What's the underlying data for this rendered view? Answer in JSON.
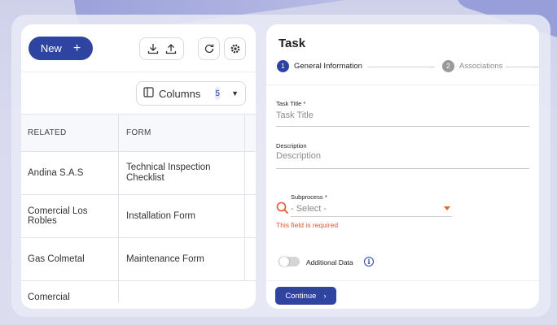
{
  "toolbar": {
    "new_label": "New",
    "new_icon": "plus-icon",
    "download_icon": "download-icon",
    "upload_icon": "upload-icon",
    "refresh_icon": "refresh-icon",
    "settings_icon": "gear-icon"
  },
  "columns_control": {
    "label": "Columns",
    "count": "5"
  },
  "table": {
    "headers": [
      "RELATED",
      "FORM"
    ],
    "rows": [
      {
        "related": "Andina S.A.S",
        "form": "Technical Inspection Checklist"
      },
      {
        "related": "Comercial Los Robles",
        "form": "Installation Form"
      },
      {
        "related": "Gas Colmetal",
        "form": "Maintenance Form"
      },
      {
        "related": "Comercial",
        "form": ""
      }
    ]
  },
  "task_form": {
    "title": "Task",
    "steps": [
      {
        "num": "1",
        "label": "General Information",
        "state": "active"
      },
      {
        "num": "2",
        "label": "Associations",
        "state": "inactive"
      }
    ],
    "task_title_label": "Task Title *",
    "task_title_placeholder": "Task Title",
    "description_label": "Description",
    "description_placeholder": "Description",
    "subprocess_label": "Subprocess *",
    "subprocess_value": "- Select -",
    "subprocess_error": "This field is required",
    "additional_data_label": "Additional Data",
    "continue_label": "Continue"
  },
  "colors": {
    "primary": "#2f44a0",
    "error": "#e3542e"
  }
}
